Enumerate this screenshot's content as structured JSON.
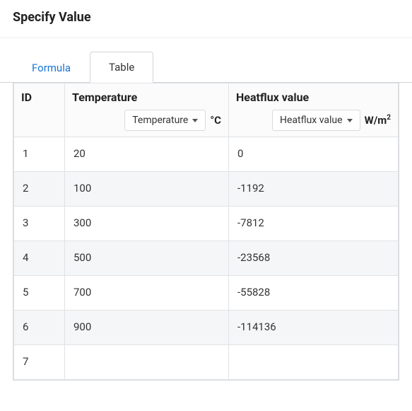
{
  "header": {
    "title": "Specify Value"
  },
  "tabs": {
    "formula": "Formula",
    "table": "Table",
    "active": "table"
  },
  "columns": {
    "id": {
      "label": "ID"
    },
    "temperature": {
      "label": "Temperature",
      "dropdown": "Temperature",
      "unit": "°C"
    },
    "heatflux": {
      "label": "Heatflux value",
      "dropdown": "Heatflux value",
      "unit_prefix": "W/m",
      "unit_exp": "2"
    }
  },
  "rows": [
    {
      "id": "1",
      "temperature": "20",
      "heatflux": "0"
    },
    {
      "id": "2",
      "temperature": "100",
      "heatflux": "-1192"
    },
    {
      "id": "3",
      "temperature": "300",
      "heatflux": "-7812"
    },
    {
      "id": "4",
      "temperature": "500",
      "heatflux": "-23568"
    },
    {
      "id": "5",
      "temperature": "700",
      "heatflux": "-55828"
    },
    {
      "id": "6",
      "temperature": "900",
      "heatflux": "-114136"
    },
    {
      "id": "7",
      "temperature": "",
      "heatflux": ""
    }
  ],
  "chart_data": {
    "type": "table",
    "columns": [
      "ID",
      "Temperature (°C)",
      "Heatflux value (W/m²)"
    ],
    "rows": [
      [
        1,
        20,
        0
      ],
      [
        2,
        100,
        -1192
      ],
      [
        3,
        300,
        -7812
      ],
      [
        4,
        500,
        -23568
      ],
      [
        5,
        700,
        -55828
      ],
      [
        6,
        900,
        -114136
      ]
    ]
  }
}
